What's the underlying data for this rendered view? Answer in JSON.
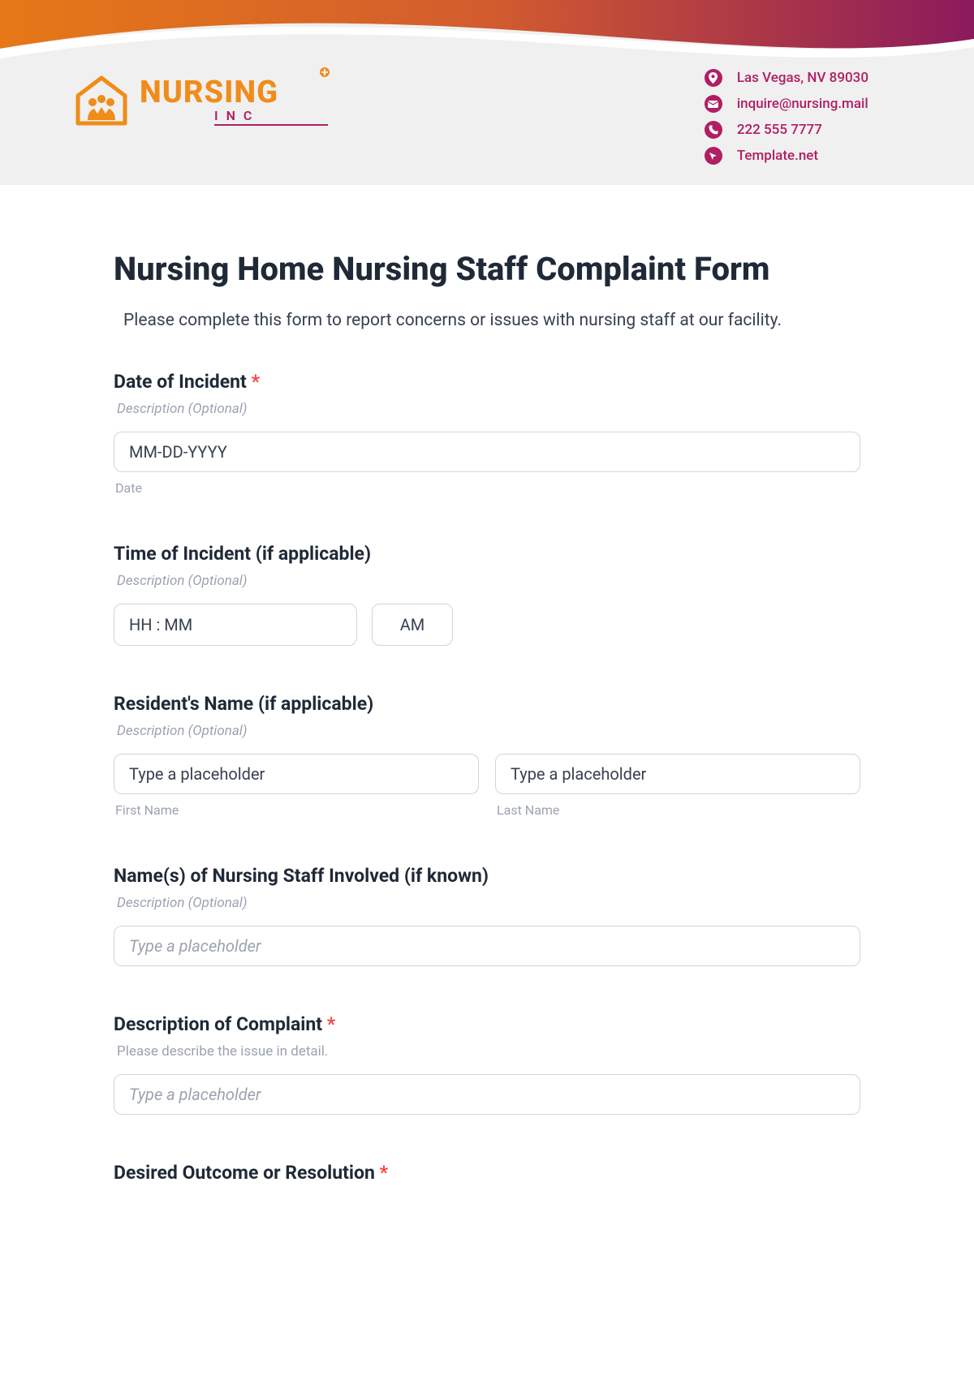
{
  "header": {
    "logo": {
      "line1": "NURSING",
      "line2": "INC"
    },
    "contact": {
      "address": "Las Vegas, NV 89030",
      "email": "inquire@nursing.mail",
      "phone": "222 555 7777",
      "website": "Template.net"
    }
  },
  "form": {
    "title": "Nursing Home Nursing Staff Complaint Form",
    "intro": "Please complete this form to report concerns or issues with nursing staff at our facility.",
    "fields": {
      "date_of_incident": {
        "label": "Date of Incident",
        "required": true,
        "desc": "Description (Optional)",
        "placeholder": "MM-DD-YYYY",
        "sub": "Date"
      },
      "time_of_incident": {
        "label": "Time of Incident (if applicable)",
        "desc": "Description (Optional)",
        "placeholder": "HH : MM",
        "ampm": "AM"
      },
      "resident_name": {
        "label": "Resident's Name (if applicable)",
        "desc": "Description (Optional)",
        "first_placeholder": "Type a placeholder",
        "first_sub": "First Name",
        "last_placeholder": "Type a placeholder",
        "last_sub": "Last Name"
      },
      "staff_involved": {
        "label": "Name(s) of Nursing Staff Involved (if known)",
        "desc": "Description (Optional)",
        "placeholder": "Type a placeholder"
      },
      "complaint_desc": {
        "label": "Description of Complaint",
        "required": true,
        "desc": "Please describe the issue in detail.",
        "placeholder": "Type a placeholder"
      },
      "desired_outcome": {
        "label": "Desired Outcome or Resolution",
        "required": true
      }
    }
  }
}
